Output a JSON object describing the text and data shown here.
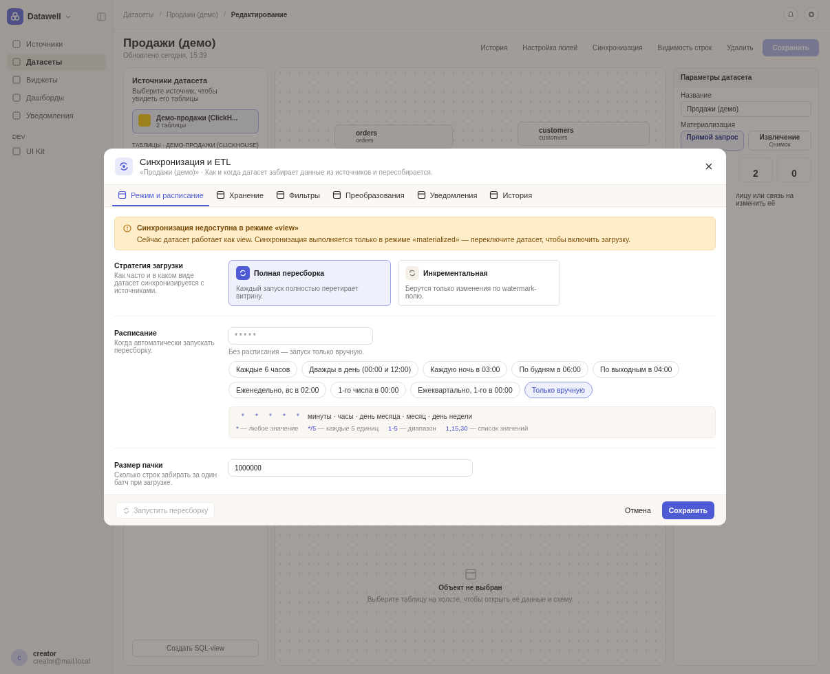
{
  "app": {
    "brand": "Datawell",
    "nav": [
      {
        "label": "Источники",
        "selected": false
      },
      {
        "label": "Датасеты",
        "selected": true
      },
      {
        "label": "Виджеты",
        "selected": false
      },
      {
        "label": "Дашборды",
        "selected": false
      },
      {
        "label": "Уведомления",
        "selected": false
      }
    ],
    "section": "DEV",
    "dev_nav": [
      {
        "label": "UI Kit",
        "selected": false
      }
    ],
    "user": {
      "initial": "c",
      "name": "creator",
      "email": "creator@mail.local"
    }
  },
  "breadcrumbs": [
    "Датасеты",
    "Продажи (демо)",
    "Редактирование"
  ],
  "breadcrumb_separator": "/",
  "page": {
    "title": "Продажи (демо)",
    "updated": "Обновлено сегодня, 15:39",
    "actions": [
      "История",
      "Настройка полей",
      "Синхронизация",
      "Видимость строк",
      "Удалить"
    ],
    "save": {
      "label": "Сохранить",
      "disabled": true
    }
  },
  "sources_panel": {
    "title": "Источники датасета",
    "hint": "Выберите источник, чтобы увидеть его таблицы",
    "source": {
      "name": "Демо-продажи (ClickH...",
      "meta": "2 таблицы",
      "selected": true
    },
    "tables_label": "ТАБЛИЦЫ · ДЕМО-ПРОДАЖИ (CLICKHOUSE)",
    "create_button": "Создать SQL-view"
  },
  "canvas": {
    "nodes": [
      {
        "title": "orders",
        "subtitle": "orders"
      },
      {
        "title": "customers",
        "subtitle": "customers"
      }
    ],
    "empty_title": "Объект не выбран",
    "empty_text": "Выберите таблицу на холсте, чтобы открыть её данные и схему."
  },
  "params_panel": {
    "title": "Параметры датасета",
    "name_label": "Название",
    "name_value": "Продажи (демо)",
    "mat_label": "Материализация",
    "mat_options": [
      {
        "label": "Прямой запрос",
        "selected": true
      },
      {
        "label": "Извлечение",
        "sub": "Снимок",
        "selected": false
      }
    ],
    "stats": [
      "2",
      "0"
    ],
    "hint_lines": [
      "лицу или связь на",
      "изменить её"
    ]
  },
  "modal": {
    "title": "Синхронизация и ETL",
    "subtitle": "«Продажи (демо)» · Как и когда датасет забирает данные из источников и пересобирается.",
    "tabs": [
      {
        "label": "Режим и расписание",
        "selected": true
      },
      {
        "label": "Хранение",
        "selected": false
      },
      {
        "label": "Фильтры",
        "selected": false
      },
      {
        "label": "Преобразования",
        "selected": false
      },
      {
        "label": "Уведомления",
        "selected": false
      },
      {
        "label": "История",
        "selected": false
      }
    ],
    "alert": {
      "title": "Синхронизация недоступна в режиме «view»",
      "text": "Сейчас датасет работает как view. Синхронизация выполняется только в режиме «materialized» — переключите датасет, чтобы включить загрузку."
    },
    "strategy": {
      "label": "Стратегия загрузки",
      "description": "Как часто и в каком виде датасет синхронизируется с источниками.",
      "options": [
        {
          "title": "Полная пересборка",
          "description": "Каждый запуск полностью перетирает витрину.",
          "selected": true
        },
        {
          "title": "Инкрементальная",
          "description": "Берутся только изменения по watermark-полю.",
          "selected": false
        }
      ]
    },
    "schedule": {
      "label": "Расписание",
      "description": "Когда автоматически запускать пересборку.",
      "placeholder": "* * * * *",
      "hint": "Без расписания — запуск только вручную.",
      "presets": [
        {
          "label": "Каждые 6 часов",
          "selected": false
        },
        {
          "label": "Дважды в день (00:00 и 12:00)",
          "selected": false
        },
        {
          "label": "Каждую ночь в 03:00",
          "selected": false
        },
        {
          "label": "По будням в 06:00",
          "selected": false
        },
        {
          "label": "По выходным в 04:00",
          "selected": false
        },
        {
          "label": "Еженедельно, вс в 02:00",
          "selected": false
        },
        {
          "label": "1-го числа в 00:00",
          "selected": false
        },
        {
          "label": "Ежеквартально, 1-го в 00:00",
          "selected": false
        },
        {
          "label": "Только вручную",
          "selected": true
        }
      ],
      "cron_fields": [
        "*",
        "*",
        "*",
        "*",
        "*"
      ],
      "cron_caption": "минуты · часы · день месяца · месяц · день недели",
      "legend": [
        {
          "code": "*",
          "text": "— любое значение"
        },
        {
          "code": "*/5",
          "text": "— каждые 5 единиц"
        },
        {
          "code": "1-5",
          "text": "— диапазон"
        },
        {
          "code": "1,15,30",
          "text": "— список значений"
        }
      ]
    },
    "batch": {
      "label": "Размер пачки",
      "description": "Сколько строк забирать за один батч при загрузке.",
      "value": "1000000"
    },
    "footer": {
      "run": {
        "label": "Запустить пересборку",
        "disabled": true
      },
      "cancel": "Отмена",
      "save": "Сохранить"
    }
  }
}
